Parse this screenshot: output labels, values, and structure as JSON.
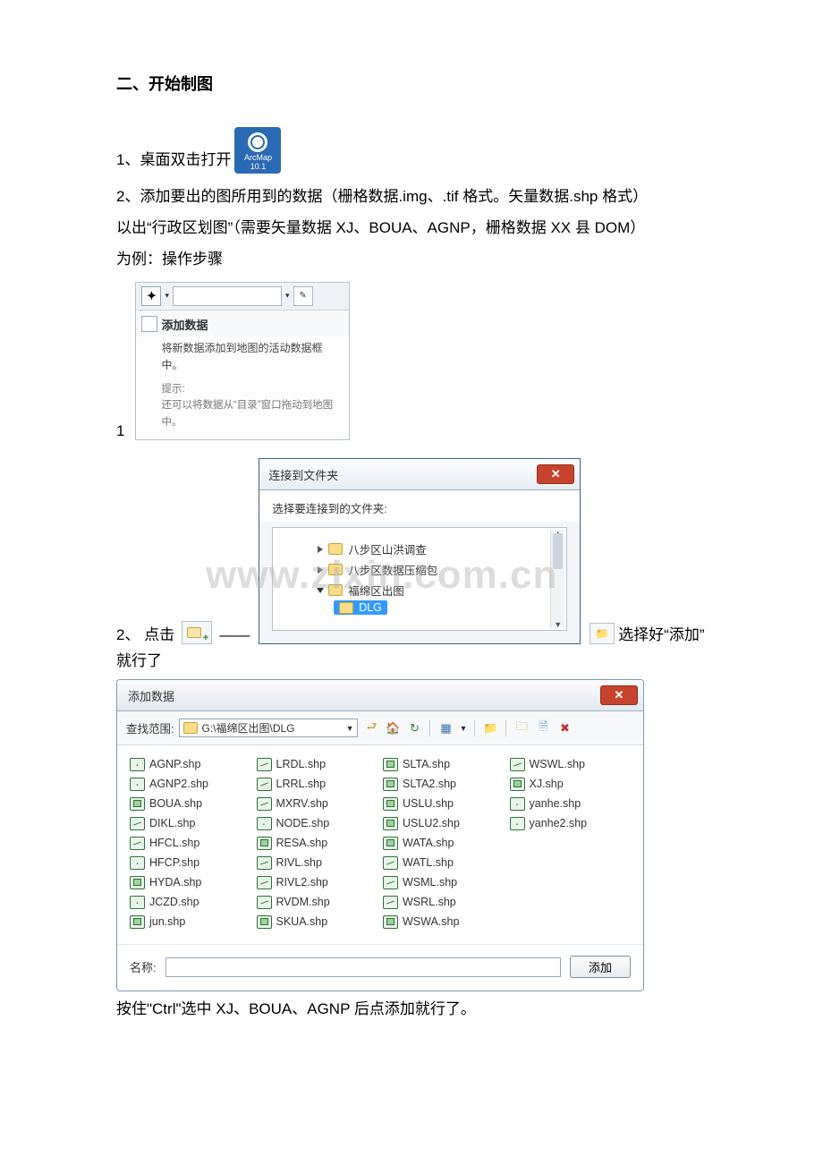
{
  "heading": "二、开始制图",
  "step1": {
    "prefix": "1、桌面双击打开",
    "icon": {
      "name": "ArcMap",
      "ver": "10.1"
    }
  },
  "step2": {
    "l1": "2、添加要出的图所用到的数据（栅格数据.img、.tif 格式。矢量数据.shp 格式）",
    "l2": "以出“行政区划图”（需要矢量数据 XJ、BOUA、AGNP，栅格数据 XX 县 DOM）",
    "l3": "为例：操作步骤"
  },
  "ss1": {
    "title": "添加数据",
    "body": "将新数据添加到地图的活动数据框中。",
    "hint_label": "提示:",
    "hint": "还可以将数据从“目录”窗口拖动到地图中。",
    "row_num": "1"
  },
  "row2": {
    "pre": "2、 点击",
    "dash": "——",
    "post": "选择好“添加”"
  },
  "ss2": {
    "title": "连接到文件夹",
    "label": "选择要连接到的文件夹:",
    "tree": [
      "八步区山洪调查",
      "八步区数据压缩包",
      "福绵区出图",
      "DLG"
    ]
  },
  "row3": "就行了",
  "ss3": {
    "title": "添加数据",
    "scope_label": "查找范围:",
    "scope_value": "G:\\福绵区出图\\DLG",
    "files": [
      {
        "n": "AGNP.shp",
        "t": "pt"
      },
      {
        "n": "LRDL.shp",
        "t": "ln"
      },
      {
        "n": "SLTA.shp",
        "t": "po"
      },
      {
        "n": "WSWL.shp",
        "t": "ln"
      },
      {
        "n": "AGNP2.shp",
        "t": "pt"
      },
      {
        "n": "LRRL.shp",
        "t": "ln"
      },
      {
        "n": "SLTA2.shp",
        "t": "po"
      },
      {
        "n": "XJ.shp",
        "t": "po"
      },
      {
        "n": "BOUA.shp",
        "t": "po"
      },
      {
        "n": "MXRV.shp",
        "t": "ln"
      },
      {
        "n": "USLU.shp",
        "t": "po"
      },
      {
        "n": "yanhe.shp",
        "t": "pt"
      },
      {
        "n": "DIKL.shp",
        "t": "ln"
      },
      {
        "n": "NODE.shp",
        "t": "pt"
      },
      {
        "n": "USLU2.shp",
        "t": "po"
      },
      {
        "n": "yanhe2.shp",
        "t": "pt"
      },
      {
        "n": "HFCL.shp",
        "t": "ln"
      },
      {
        "n": "RESA.shp",
        "t": "po"
      },
      {
        "n": "WATA.shp",
        "t": "po"
      },
      {
        "n": "",
        "t": ""
      },
      {
        "n": "HFCP.shp",
        "t": "pt"
      },
      {
        "n": "RIVL.shp",
        "t": "ln"
      },
      {
        "n": "WATL.shp",
        "t": "ln"
      },
      {
        "n": "",
        "t": ""
      },
      {
        "n": "HYDA.shp",
        "t": "po"
      },
      {
        "n": "RIVL2.shp",
        "t": "ln"
      },
      {
        "n": "WSML.shp",
        "t": "ln"
      },
      {
        "n": "",
        "t": ""
      },
      {
        "n": "JCZD.shp",
        "t": "pt"
      },
      {
        "n": "RVDM.shp",
        "t": "ln"
      },
      {
        "n": "WSRL.shp",
        "t": "ln"
      },
      {
        "n": "",
        "t": ""
      },
      {
        "n": "jun.shp",
        "t": "po"
      },
      {
        "n": "SKUA.shp",
        "t": "po"
      },
      {
        "n": "WSWA.shp",
        "t": "po"
      },
      {
        "n": "",
        "t": ""
      }
    ],
    "name_label": "名称:",
    "add_btn": "添加"
  },
  "footer": "按住\"Ctrl\"选中 XJ、BOUA、AGNP 后点添加就行了。",
  "watermark": "www.zixin.com.cn"
}
